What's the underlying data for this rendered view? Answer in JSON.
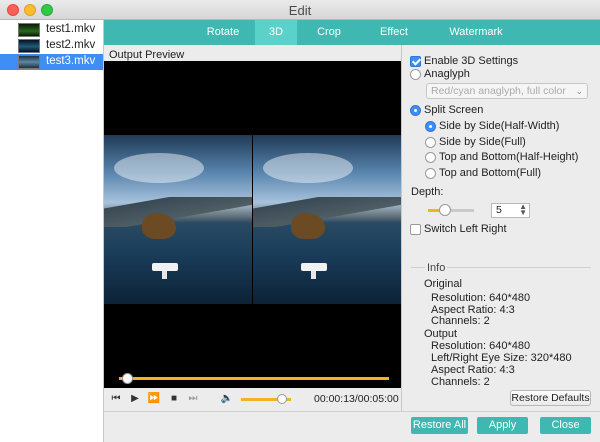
{
  "window": {
    "title": "Edit"
  },
  "files": [
    {
      "name": "test1.mkv",
      "selected": false
    },
    {
      "name": "test2.mkv",
      "selected": false
    },
    {
      "name": "test3.mkv",
      "selected": true
    }
  ],
  "tabs": [
    {
      "label": "Rotate",
      "active": false
    },
    {
      "label": "3D",
      "active": true
    },
    {
      "label": "Crop",
      "active": false
    },
    {
      "label": "Effect",
      "active": false
    },
    {
      "label": "Watermark",
      "active": false
    }
  ],
  "preview": {
    "label": "Output Preview",
    "seek_fraction": 0.03,
    "volume_fraction": 0.82,
    "time": "00:00:13/00:05:00"
  },
  "settings": {
    "enable_label": "Enable 3D Settings",
    "enable_checked": true,
    "anaglyph_label": "Anaglyph",
    "anaglyph_selected": false,
    "anaglyph_option": "Red/cyan anaglyph, full color",
    "split_label": "Split Screen",
    "split_selected": true,
    "split_modes": [
      {
        "label": "Side by Side(Half-Width)",
        "selected": true
      },
      {
        "label": "Side by Side(Full)",
        "selected": false
      },
      {
        "label": "Top and Bottom(Half-Height)",
        "selected": false
      },
      {
        "label": "Top and Bottom(Full)",
        "selected": false
      }
    ],
    "depth_label": "Depth:",
    "depth_value": "5",
    "switch_label": "Switch Left Right",
    "switch_checked": false
  },
  "info": {
    "title": "Info",
    "original_label": "Original",
    "original": {
      "resolution": "Resolution: 640*480",
      "aspect": "Aspect Ratio: 4:3",
      "channels": "Channels: 2"
    },
    "output_label": "Output",
    "output": {
      "resolution": "Resolution: 640*480",
      "eye_size": "Left/Right Eye Size: 320*480",
      "aspect": "Aspect Ratio: 4:3",
      "channels": "Channels: 2"
    }
  },
  "buttons": {
    "restore_defaults": "Restore Defaults",
    "restore_all": "Restore All",
    "apply": "Apply",
    "close": "Close"
  },
  "colors": {
    "accent": "#3fb8b1",
    "tab_active": "#5ad2ca",
    "selection": "#3e8ef4",
    "progress": "#f0b324"
  }
}
